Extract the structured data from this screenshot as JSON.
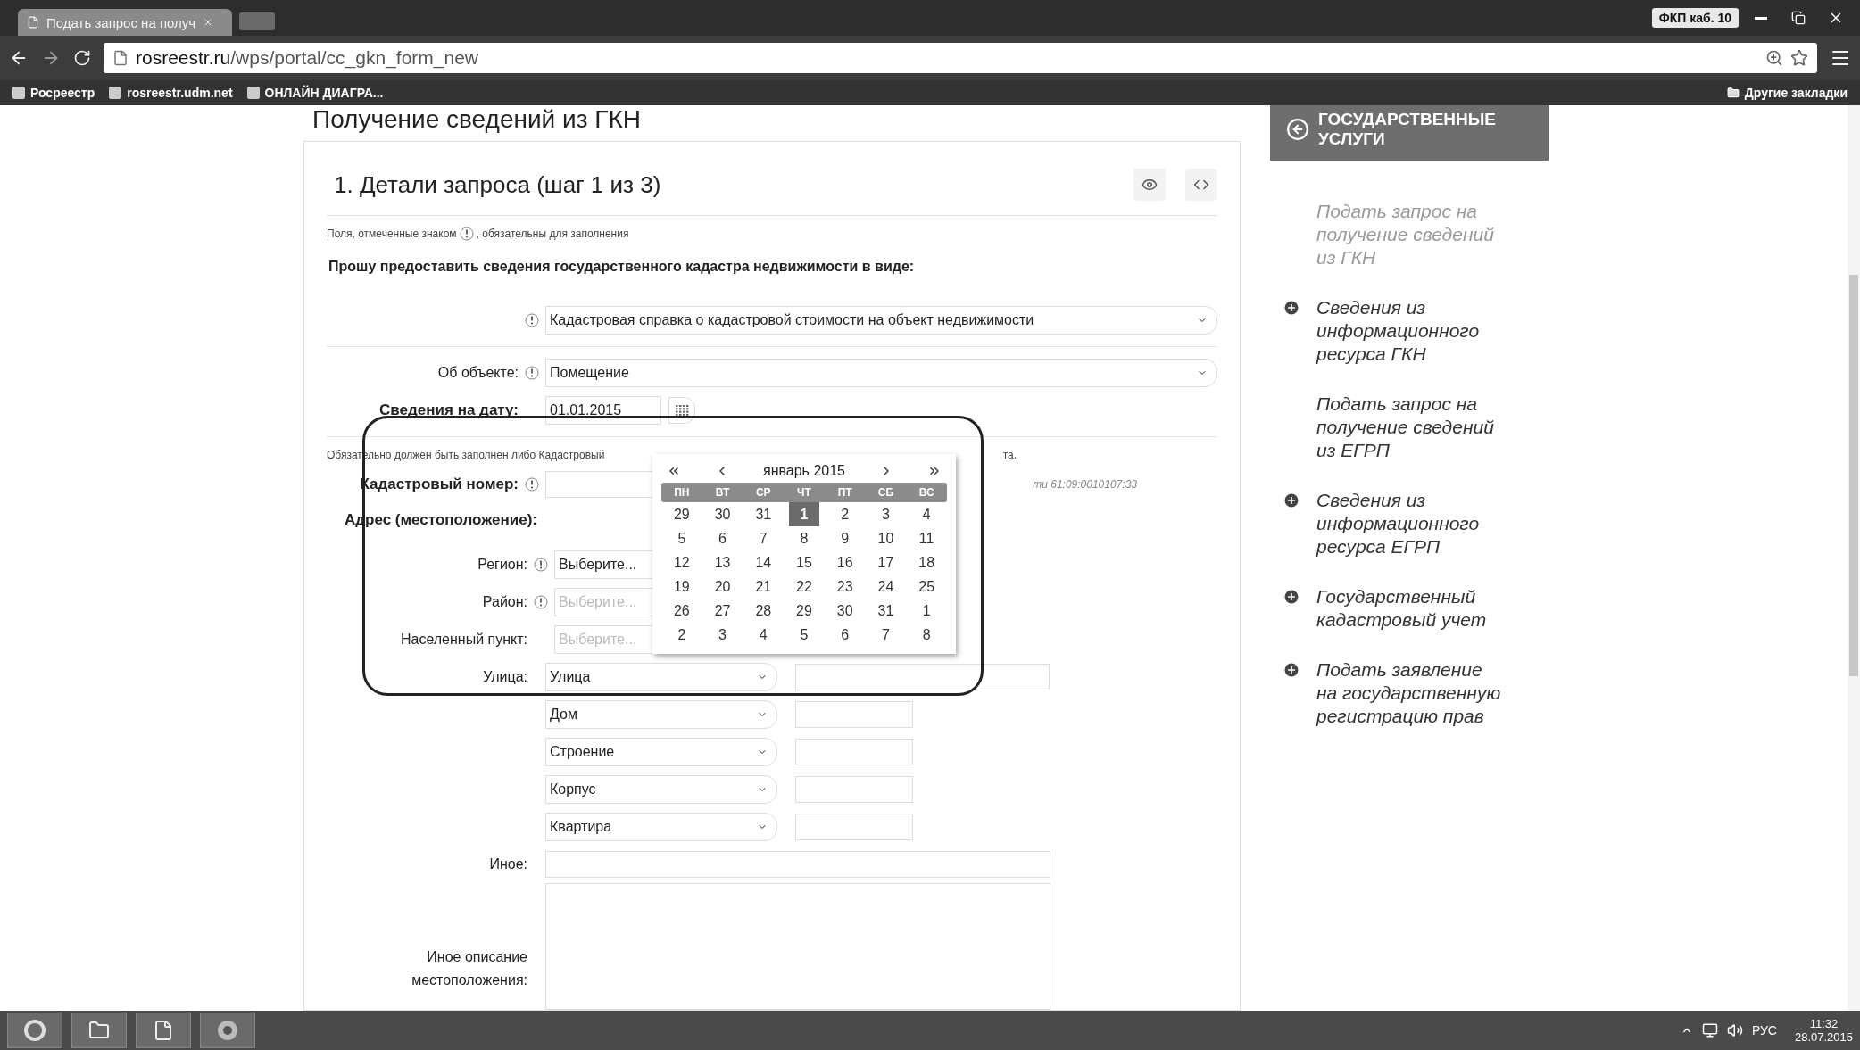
{
  "browser": {
    "tab_title": "Подать запрос на получ",
    "user_badge": "ФКП каб. 10",
    "address_host": "rosreestr.ru",
    "address_path": "/wps/portal/cc_gkn_form_new",
    "bookmarks": [
      "Росреестр",
      "rosreestr.udm.net",
      "ОНЛАЙН ДИАГРА..."
    ],
    "other_bookmarks": "Другие закладки"
  },
  "page": {
    "heading": "Получение сведений из ГКН",
    "form": {
      "title": "1. Детали запроса (шаг 1 из 3)",
      "required_note_before": "Поля, отмеченные знаком",
      "required_note_after": ", обязательны для заполнения",
      "request_label": "Прошу предоставить сведения государственного кадастра недвижимости в виде:",
      "document_type": {
        "value": "Кадастровая справка о кадастровой стоимости на объект недвижимости",
        "required": true
      },
      "object": {
        "label": "Об объекте:",
        "value": "Помещение",
        "required": true
      },
      "date": {
        "label": "Сведения на дату:",
        "value": "01.01.2015"
      },
      "notice": [
        "Обязательно должен быть заполнен либо Кадастровый",
        "та."
      ],
      "cadastral": {
        "label": "Кадастровый номер:",
        "hint": "ти 61:09:0010107:33",
        "required": true
      },
      "address_label": "Адрес (местоположение):",
      "location_fields": [
        {
          "label": "Регион:",
          "value": "Выберите...",
          "required": true,
          "disabled": false
        },
        {
          "label": "Район:",
          "value": "Выберите...",
          "required": true,
          "disabled": true
        },
        {
          "label": "Населенный пункт:",
          "value": "Выберите...",
          "required": false,
          "disabled": true
        }
      ],
      "address_parts": [
        {
          "label": "Улица:",
          "value": "Улица",
          "wide": true
        },
        {
          "value": "Дом",
          "wide": false
        },
        {
          "value": "Строение",
          "wide": false
        },
        {
          "value": "Корпус",
          "wide": false
        },
        {
          "value": "Квартира",
          "wide": false
        }
      ],
      "other_label": "Иное:",
      "description_label": "Иное описание местоположения:"
    },
    "datepicker": {
      "month": "январь 2015",
      "weekdays": [
        "ПН",
        "ВТ",
        "СР",
        "ЧТ",
        "ПТ",
        "СБ",
        "ВС"
      ],
      "weeks": [
        [
          {
            "day": "29",
            "selected": false
          },
          {
            "day": "30",
            "selected": false
          },
          {
            "day": "31",
            "selected": false
          },
          {
            "day": "1",
            "selected": true
          },
          {
            "day": "2",
            "selected": false
          },
          {
            "day": "3",
            "selected": false
          },
          {
            "day": "4",
            "selected": false
          }
        ],
        [
          {
            "day": "5",
            "selected": false
          },
          {
            "day": "6",
            "selected": false
          },
          {
            "day": "7",
            "selected": false
          },
          {
            "day": "8",
            "selected": false
          },
          {
            "day": "9",
            "selected": false
          },
          {
            "day": "10",
            "selected": false
          },
          {
            "day": "11",
            "selected": false
          }
        ],
        [
          {
            "day": "12",
            "selected": false
          },
          {
            "day": "13",
            "selected": false
          },
          {
            "day": "14",
            "selected": false
          },
          {
            "day": "15",
            "selected": false
          },
          {
            "day": "16",
            "selected": false
          },
          {
            "day": "17",
            "selected": false
          },
          {
            "day": "18",
            "selected": false
          }
        ],
        [
          {
            "day": "19",
            "selected": false
          },
          {
            "day": "20",
            "selected": false
          },
          {
            "day": "21",
            "selected": false
          },
          {
            "day": "22",
            "selected": false
          },
          {
            "day": "23",
            "selected": false
          },
          {
            "day": "24",
            "selected": false
          },
          {
            "day": "25",
            "selected": false
          }
        ],
        [
          {
            "day": "26",
            "selected": false
          },
          {
            "day": "27",
            "selected": false
          },
          {
            "day": "28",
            "selected": false
          },
          {
            "day": "29",
            "selected": false
          },
          {
            "day": "30",
            "selected": false
          },
          {
            "day": "31",
            "selected": false
          },
          {
            "day": "1",
            "selected": false
          }
        ],
        [
          {
            "day": "2",
            "selected": false
          },
          {
            "day": "3",
            "selected": false
          },
          {
            "day": "4",
            "selected": false
          },
          {
            "day": "5",
            "selected": false
          },
          {
            "day": "6",
            "selected": false
          },
          {
            "day": "7",
            "selected": false
          },
          {
            "day": "8",
            "selected": false
          }
        ]
      ]
    }
  },
  "sidebar": {
    "title": "ГОСУДАРСТВЕННЫЕ УСЛУГИ",
    "items": [
      {
        "label": "Подать запрос на получение сведений из ГКН",
        "kind": "link",
        "selected": true
      },
      {
        "label": "Сведения из информационного ресурса ГКН",
        "kind": "expandable",
        "selected": false
      },
      {
        "label": "Подать запрос на получение сведений из ЕГРП",
        "kind": "link",
        "selected": false
      },
      {
        "label": "Сведения из информационного ресурса ЕГРП",
        "kind": "expandable",
        "selected": false
      },
      {
        "label": "Государственный кадастровый учет",
        "kind": "expandable",
        "selected": false
      },
      {
        "label": "Подать заявление на государственную регистрацию прав",
        "kind": "expandable",
        "selected": false
      }
    ]
  },
  "taskbar": {
    "language": "РУС",
    "time": "11:32",
    "date": "28.07.2015"
  }
}
